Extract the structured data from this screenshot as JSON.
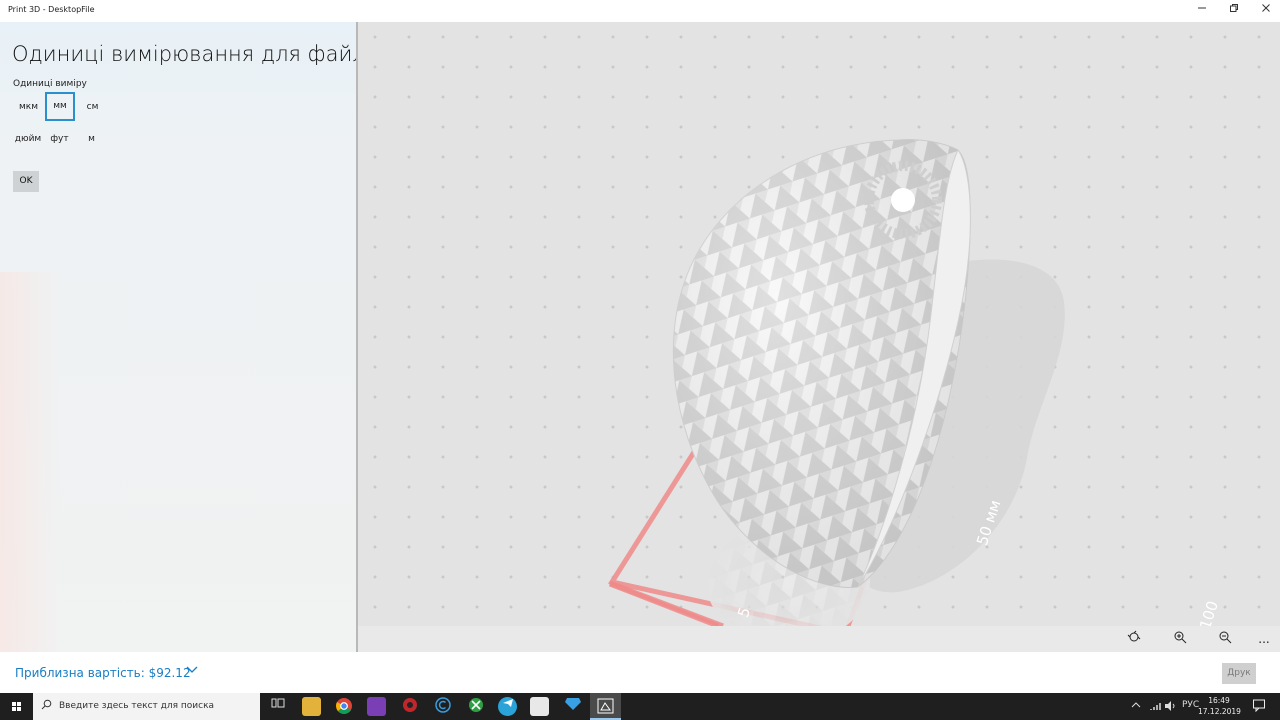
{
  "window": {
    "title": "Print 3D - DesktopFile"
  },
  "panel": {
    "title": "Одиниці вимірювання для файлу",
    "units_label": "Одиниці виміру",
    "units": [
      {
        "label": "мкм",
        "selected": false
      },
      {
        "label": "мм",
        "selected": true
      },
      {
        "label": "см",
        "selected": false
      },
      {
        "label": "дюйм",
        "selected": false
      },
      {
        "label": "фут",
        "selected": false
      },
      {
        "label": "м",
        "selected": false
      }
    ],
    "ok_label": "OK"
  },
  "viewport": {
    "dimension_label_right": "50 мм",
    "dimension_label_far": "100",
    "dimension_label_bottom": "5",
    "toolbar_icons": [
      "view-3d-icon",
      "zoom-in-icon",
      "zoom-out-icon",
      "more-icon"
    ],
    "more_glyph": "..."
  },
  "bottom": {
    "cost": "Приблизна вартість: $92.12",
    "print_label": "Друк"
  },
  "taskbar": {
    "search_placeholder": "Введите здесь текст для поиска",
    "lang": "РУС",
    "time": "16:49",
    "date": "17.12.2019"
  },
  "colors": {
    "accent": "#2a8fce",
    "cost_text": "#1a7ec4",
    "bed_outline": "#ef8a8a"
  }
}
